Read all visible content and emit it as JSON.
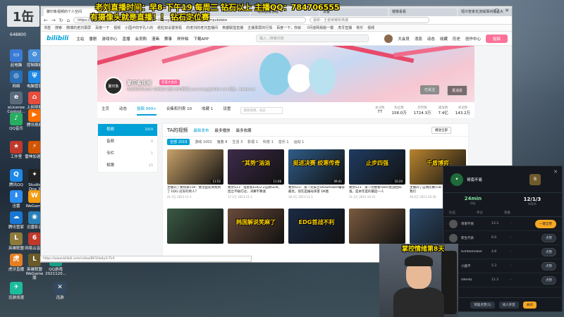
{
  "overlay": {
    "line1": "老刘直播时间：早8-下午19   每周三  钻石以上          主播QQ：784706555",
    "line2": "有摄像头就是直播！！    钻石定位赛",
    "logo": "1缶",
    "fans": "648800",
    "cam_caption": "掌控情绪第8天"
  },
  "desktop_icons": [
    {
      "label": "此电脑",
      "color": "#3a7bd5",
      "glyph": "▭"
    },
    {
      "label": "控制面板",
      "color": "#4a90d9",
      "glyph": "⚙"
    },
    {
      "label": "网络",
      "color": "#2a6fb8",
      "glyph": "◎"
    },
    {
      "label": "eLicense Control...",
      "color": "#5b6b7b",
      "glyph": "e"
    },
    {
      "label": "上网导航",
      "color": "#e74c3c",
      "glyph": "⌂"
    },
    {
      "label": "QQ音乐",
      "color": "#27ae60",
      "glyph": "♪"
    },
    {
      "label": "电脑管家",
      "color": "#1e88e5",
      "glyph": "⛨"
    },
    {
      "label": "腾讯视频",
      "color": "#ff6f00",
      "glyph": "▶"
    },
    {
      "label": "工作室",
      "color": "#c0392b",
      "glyph": "★"
    },
    {
      "label": "雷神加速器",
      "color": "#d35400",
      "glyph": "⚡"
    },
    {
      "label": "腾讯QQ",
      "color": "#1e88e5",
      "glyph": "Q"
    },
    {
      "label": "Studio One 3",
      "color": "#222222",
      "glyph": "✦"
    },
    {
      "label": "迅雷",
      "color": "#2d8cf0",
      "glyph": "⬇"
    },
    {
      "label": "WeGame",
      "color": "#f39c12",
      "glyph": "W"
    },
    {
      "label": "腾讯管家",
      "color": "#1976d2",
      "glyph": "☁"
    },
    {
      "label": "迅雷影音",
      "color": "#2980b9",
      "glyph": "◉"
    },
    {
      "label": "英雄联盟",
      "color": "#8e7b3b",
      "glyph": "L"
    },
    {
      "label": "网易云音乐",
      "color": "#c0392b",
      "glyph": "6"
    },
    {
      "label": "虎牙直播",
      "color": "#e67e22",
      "glyph": "虎"
    },
    {
      "label": "英雄联盟WeGame版",
      "color": "#6b5a2a",
      "glyph": "L"
    },
    {
      "label": "QQ游戏 2021120...",
      "color": "#16a085",
      "glyph": "G"
    },
    {
      "label": "迅游加速",
      "color": "#1abc9c",
      "glyph": "✈"
    },
    {
      "label": "迅游",
      "color": "#34495e",
      "glyph": "✕"
    }
  ],
  "browser": {
    "tabs": [
      {
        "label": "聚印象视频的个人空间",
        "active": true
      },
      {
        "label": "虎牙直播 - 在线",
        "active": false
      },
      {
        "label": "哔哩哔哩",
        "active": false
      },
      {
        "label": "一站式直播管理",
        "active": false
      },
      {
        "label": "设备",
        "active": false
      },
      {
        "label": "镜像看看",
        "active": false
      },
      {
        "label": "观众管家长流域深圳报名大",
        "active": false
      }
    ],
    "url": "https://space.bilibili.com/3609945/video?tid=0&page=1&keyword=&order=pubdate",
    "search_placeholder": "最新：王者荣耀新英雄",
    "bookmarks": [
      "书签",
      "搜索",
      "微博的老刘录屏",
      "百度一下",
      "视频",
      "小国卢的字孔人的",
      "纸粒如设置常看",
      "的老刘的老刘直播间",
      "英雄联盟直播",
      "主播录屏的行情",
      "百度一下，你就",
      "《问道网易版一键",
      "虎牙直播",
      "常乐",
      "视频"
    ],
    "status_url": "https://www.bilibili.com/video/BV1Ha4y1r7LA",
    "window_controls": [
      "–",
      "▢",
      "✕"
    ]
  },
  "bili": {
    "logo": "bilibili",
    "header_nav": [
      "主站",
      "番剧",
      "游戏中心",
      "直播",
      "会员购",
      "漫画",
      "赛事",
      "祥伴柏",
      "下载APP"
    ],
    "header_search": "输入...搜索内容",
    "header_right": [
      "大会员",
      "消息",
      "动态",
      "收藏",
      "历史",
      "创作中心"
    ],
    "upload": "投稿",
    "up": {
      "avatar_text": "聚印象",
      "name": "聚印象视频",
      "level": "年度大会员",
      "desc": "英雄联盟职业选手 游戏解说 直播 合作请联系 juyinxiang@bilibili.com 投稿...  freelancer",
      "follow": "已关注",
      "message": "发消息"
    },
    "tabs": [
      {
        "label": "主页",
        "active": false
      },
      {
        "label": "动态",
        "active": false
      },
      {
        "label": "投稿 999+",
        "active": true
      },
      {
        "label": "合集和列表 10",
        "active": false
      },
      {
        "label": "收藏 1",
        "active": false
      },
      {
        "label": "设置",
        "active": false
      }
    ],
    "tab_search": "搜索视频、动态",
    "stats": [
      {
        "label": "关注数",
        "value": "77"
      },
      {
        "label": "粉丝数",
        "value": "158.0万"
      },
      {
        "label": "获赞数",
        "value": "1724.3万"
      },
      {
        "label": "播放数",
        "value": "7.4亿"
      },
      {
        "label": "阅读数",
        "value": "143.2万"
      }
    ],
    "left_menu": [
      {
        "label": "视频",
        "count": "1019",
        "active": true
      },
      {
        "label": "音频",
        "count": "0",
        "active": false
      },
      {
        "label": "专栏",
        "count": "1",
        "active": false
      },
      {
        "label": "相簿",
        "count": "15",
        "active": false
      }
    ],
    "main_title": "TA的视频",
    "sort": [
      "最新发布",
      "最多播放",
      "最多收藏"
    ],
    "play_all": "播放全部",
    "categories": [
      "全部 1019",
      "游戏 1002",
      "鬼畜 8",
      "生活 3",
      "影视 1",
      "科技 1",
      "音乐 1",
      "运动 1"
    ],
    "videos": [
      {
        "title": "主播刘了要找来158：整活型轮到找到了 EDG 冠军的男人？",
        "views": "41.4万",
        "date": "2021-11-1",
        "dur": "11:52",
        "cap": "",
        "bg": "#c9a26a"
      },
      {
        "title": "要焚S11：准星惹EDG2:2击败GEN，团立不碰打过，决赛不算速",
        "views": "17.2万",
        "date": "2021-11-1",
        "dur": "11:08",
        "cap": "\"其势\"汹汹",
        "bg": "#3d2b4a"
      },
      {
        "title": "要焚S11：第一完美吉Showmaker编得最优，现在是编号侠客 DK胜",
        "views": "16.3万",
        "date": "2021-11-1",
        "dur": "09:41",
        "cap": "挺进决赛 绞寒传奇",
        "bg": "#2f5d8a"
      },
      {
        "title": "要焚S11：第一完整者Faker星战拉四强，是本年度的最后一人",
        "views": "11.2万",
        "date": "2021-10-31",
        "dur": "10:20",
        "cap": "止步四强",
        "bg": "#1f3c62"
      },
      {
        "title": "主播刘了这两比赛158：年后的决赛为我们",
        "views": "26.4万",
        "date": "2021-10-30",
        "dur": "08:11",
        "cap": "千盾博弈",
        "bg": "#b8842f"
      },
      {
        "title": "",
        "views": "",
        "date": "",
        "dur": "",
        "cap": "",
        "bg": "#3b5a44"
      },
      {
        "title": "",
        "views": "",
        "date": "",
        "dur": "",
        "cap": "韩国解说笑麻了",
        "bg": "#6a4b3a"
      },
      {
        "title": "",
        "views": "",
        "date": "",
        "dur": "",
        "cap": "EDG首战不利",
        "bg": "#1b2b44"
      },
      {
        "title": "",
        "views": "",
        "date": "",
        "dur": "",
        "cap": "",
        "bg": "#7a5a3f"
      },
      {
        "title": "",
        "views": "",
        "date": "",
        "dur": "",
        "cap": "",
        "bg": "#2c4a6a"
      }
    ]
  },
  "game": {
    "player": "哥南不易",
    "rank_glyph": "B",
    "time": "24min",
    "time_label": "时长",
    "kda": "12/1/3",
    "kda_label": "K/D/A",
    "col_headers": [
      "队伍",
      "评分",
      "装备"
    ],
    "rows": [
      {
        "name": "哥南不易",
        "score": "13.3",
        "btn": "一键全赞",
        "yellow": true
      },
      {
        "name": "新生代表",
        "score": "6.0",
        "btn": "点赞",
        "yellow": false
      },
      {
        "name": "tumblemaker",
        "score": "4.8",
        "btn": "点赞",
        "yellow": false
      },
      {
        "name": "小鹿不",
        "score": "5.3",
        "btn": "点赞",
        "yellow": false
      },
      {
        "name": "UNFAD",
        "score": "11.3",
        "btn": "点赞",
        "yellow": false
      }
    ],
    "foot": [
      {
        "label": "荣誉点赞(1)",
        "yellow": false
      },
      {
        "label": "找人开黑",
        "yellow": false
      },
      {
        "label": "关闭",
        "yellow": true
      }
    ],
    "close": "✕"
  }
}
